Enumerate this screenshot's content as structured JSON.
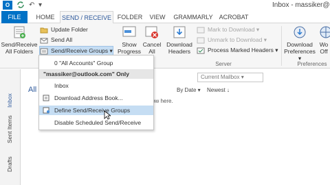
{
  "window": {
    "app_icon_label": "O",
    "title": "Inbox - massiker@ou"
  },
  "qat": {
    "send_receive_icon": "send-receive-icon",
    "undo_glyph": "↶",
    "customize_glyph": "▾"
  },
  "tabs": [
    {
      "label": "FILE"
    },
    {
      "label": "HOME"
    },
    {
      "label": "SEND / RECEIVE"
    },
    {
      "label": "FOLDER"
    },
    {
      "label": "VIEW"
    },
    {
      "label": "GRAMMARLY"
    },
    {
      "label": "ACROBAT"
    }
  ],
  "ribbon": {
    "send_receive_all": "Send/Receive All Folders",
    "update_folder": "Update Folder",
    "send_all": "Send All",
    "send_receive_groups": "Send/Receive Groups ▾",
    "show_progress": "Show Progress",
    "cancel_all": "Cancel All",
    "download_headers": "Download Headers",
    "mark_to_download": "Mark to Download ▾",
    "unmark_to_download": "Unmark to Download ▾",
    "process_marked_headers": "Process Marked Headers ▾",
    "server_group_label": "Server",
    "download_preferences": "Download Preferences ▾",
    "work_offline": "Wo Off",
    "preferences_group_label": "Preferences"
  },
  "menu": {
    "items": [
      {
        "label": "0 \"All Accounts\" Group"
      },
      {
        "label": "\"massiker@outlook.com\" Only"
      },
      {
        "label": "Inbox"
      },
      {
        "label": "Download Address Book..."
      },
      {
        "label": "Define Send/Receive Groups"
      },
      {
        "label": "Disable Scheduled Send/Receive"
      }
    ]
  },
  "mail_list": {
    "search_scope": "Current Mailbox ▾",
    "filter_all": "All",
    "sort_by": "By Date ▾",
    "sort_order": "Newest ↓",
    "empty_text": "ow here."
  },
  "folder_pane": {
    "inbox": "Inbox",
    "sent_items": "Sent Items",
    "drafts": "Drafts",
    "collapse_glyph": "›"
  },
  "colors": {
    "accent": "#0072c6",
    "ribbon_bg": "#f6f6f6",
    "hover": "#c5ddf3"
  }
}
